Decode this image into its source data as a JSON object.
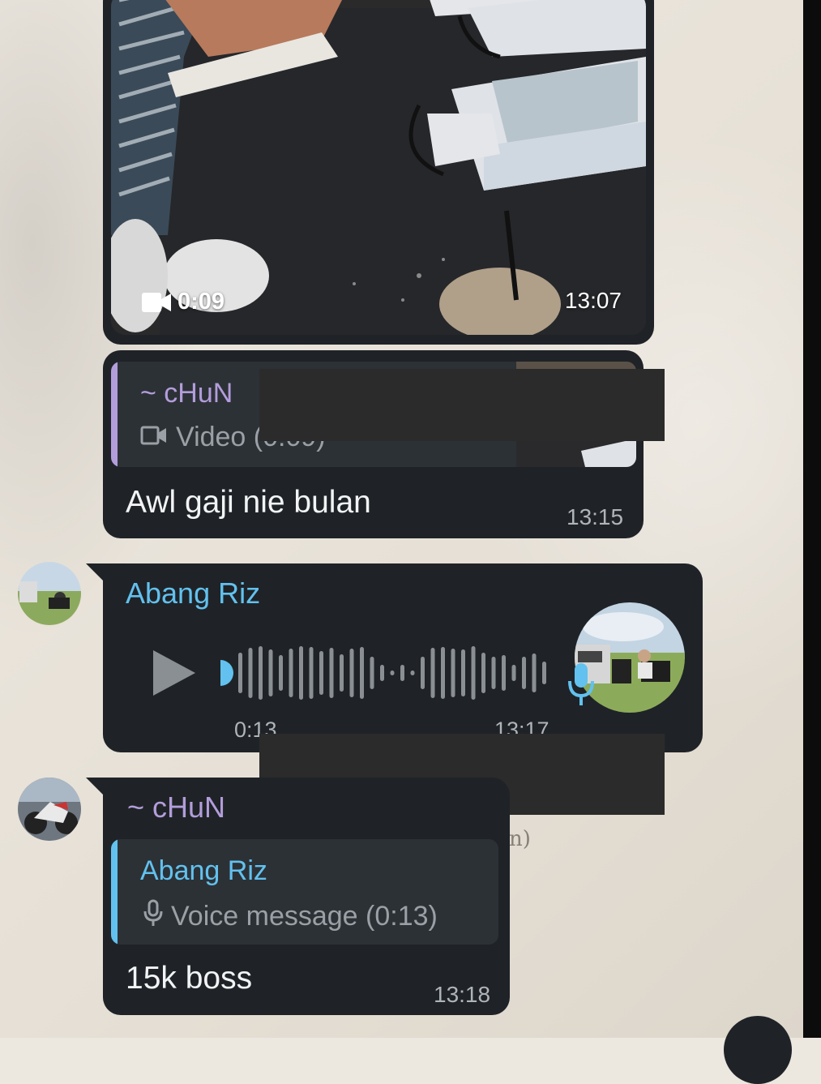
{
  "video_message": {
    "duration": "0:09",
    "time": "13:07"
  },
  "reply_message_1": {
    "quoted_sender": "~ cHuN",
    "quoted_type": "Video (0:09)",
    "text": "Awl gaji nie bulan",
    "time": "13:15"
  },
  "voice_message": {
    "sender": "Abang Riz",
    "duration": "0:13",
    "time": "13:17",
    "played_fraction": 0
  },
  "reply_message_2": {
    "sender": "~ cHuN",
    "quoted_sender": "Abang Riz",
    "quoted_type": "Voice message (0:13)",
    "text": "15k boss",
    "time": "13:18"
  },
  "background_text": {
    "fragment": "n)"
  },
  "colors": {
    "bubble": "#1f2327",
    "quote_bg": "#2c3136",
    "chun_name": "#b39ddb",
    "riz_name": "#62c1ee",
    "voice_dot": "#62c1ee",
    "waveform": "#8a8f94"
  },
  "icons": [
    "video-camera-icon",
    "play-icon",
    "microphone-icon",
    "video-outline-icon"
  ]
}
